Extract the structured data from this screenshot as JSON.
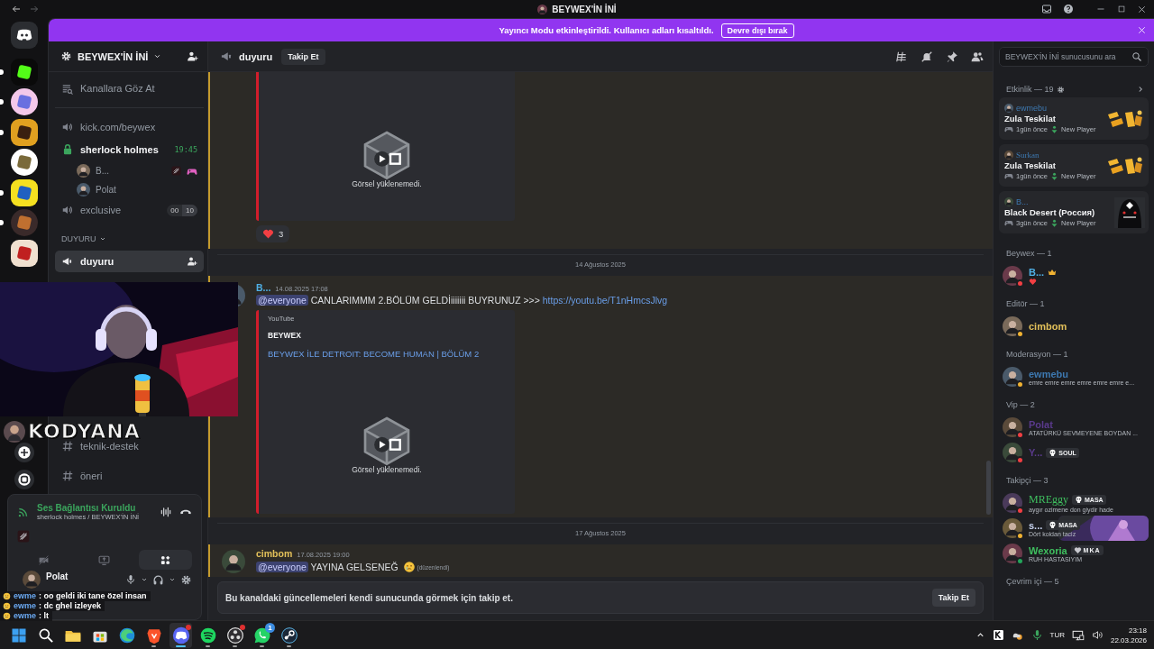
{
  "titlebar": {
    "title": "BEYWEX'İN İNİ"
  },
  "banner": {
    "text": "Yayıncı Modu etkinleştirildi. Kullanıcı adları kısaltıldı.",
    "button": "Devre dışı bırak"
  },
  "servers": [
    {
      "unread": true
    },
    {
      "unread": true
    },
    {
      "unread": true
    },
    {
      "unread": false
    },
    {
      "unread": true
    },
    {
      "unread": true
    },
    {
      "unread": false
    }
  ],
  "server": {
    "name": "BEYWEX'İN İNİ"
  },
  "channel_groups": [
    [
      {
        "kind": "browse",
        "name": "Kanallara Göz At",
        "selected": false,
        "unread": false
      },
      {
        "kind": "voice",
        "name": "kick.com/beywex",
        "selected": false,
        "unread": false
      },
      {
        "kind": "voice-locked",
        "name": "sherlock holmes",
        "timer": "19:45",
        "selected": false,
        "unread": true,
        "members": [
          {
            "name": "B...",
            "deafened": true,
            "activity": true
          },
          {
            "name": "Polat",
            "deafened": false,
            "activity": false
          }
        ]
      },
      {
        "kind": "voice",
        "name": "exclusive",
        "counter": [
          "00",
          "10"
        ],
        "selected": false,
        "unread": false
      },
      {
        "kind": "category",
        "name": "DUYURU"
      },
      {
        "kind": "announcement",
        "name": "duyuru",
        "selected": true,
        "unread": true
      }
    ],
    [
      {
        "kind": "text",
        "name": "teknik-destek",
        "selected": false,
        "unread": false
      },
      {
        "kind": "text",
        "name": "öneri",
        "selected": false,
        "unread": false
      }
    ]
  ],
  "voice_panel": {
    "status": "Ses Bağlantısı Kuruldu",
    "location": "sherlock holmes / BEYWEX'İN İNİ"
  },
  "user_panel": {
    "name": "Polat"
  },
  "chat_header": {
    "channel": "duyuru",
    "follow_button": "Takip Et"
  },
  "messages": [
    {
      "kind": "continuation",
      "mention": true,
      "embed": {
        "image_error": "Görsel yüklenemedi."
      },
      "reactions": [
        {
          "count": "3"
        }
      ]
    },
    {
      "kind": "divider",
      "text": "14 Ağustos 2025"
    },
    {
      "kind": "message",
      "mention": true,
      "author": "B...",
      "color": "#4fb0e6",
      "time": "14.08.2025 17:08",
      "mention_text": "@everyone",
      "text": "CANLARIMMM 2.BÖLÜM GELDİiiiiiii BUYRUNUZ >>>",
      "link": "https://youtu.be/T1nHmcsJlvg",
      "embed": {
        "provider": "YouTube",
        "author": "BEYWEX",
        "title": "BEYWEX İLE DETROIT: BECOME HUMAN | BÖLÜM 2",
        "image_error": "Görsel yüklenemedi."
      }
    },
    {
      "kind": "divider",
      "text": "17 Ağustos 2025"
    },
    {
      "kind": "message",
      "mention": true,
      "author": "cimbom",
      "color": "#e3c15a",
      "time": "17.08.2025 19:00",
      "mention_text": "@everyone",
      "text": "YAYINA GELSENEĞ",
      "emoji": true,
      "edited": "(düzenlendi)"
    }
  ],
  "follow_bar": {
    "text": "Bu kanaldaki güncellemeleri kendi sunucunda görmek için takip et.",
    "button": "Takip Et"
  },
  "search": {
    "placeholder": "BEYWEX'İN İNİ sunucusunu ara"
  },
  "activity": {
    "title": "Etkinlik — 19",
    "cards": [
      {
        "user": "ewmebu",
        "game": "Zula Teskilat",
        "time": "1gün önce",
        "badge": "New Player",
        "kind": "zula"
      },
      {
        "user": "Surkan",
        "game": "Zula Teskilat",
        "time": "1gün önce",
        "badge": "New Player",
        "kind": "zula"
      },
      {
        "user": "B...",
        "game": "Black Desert (Россия)",
        "time": "3gün önce",
        "badge": "New Player",
        "kind": "mask"
      }
    ]
  },
  "member_groups": [
    {
      "title": "Beywex — 1",
      "members": [
        {
          "name": "B...",
          "color": "#4fb0e6",
          "kind": "dnd",
          "crown": true,
          "status_emoji": true
        }
      ]
    },
    {
      "title": "Editör — 1",
      "members": [
        {
          "name": "cimbom",
          "color": "#e3c15a",
          "kind": "idle"
        }
      ]
    },
    {
      "title": "Moderasyon — 1",
      "members": [
        {
          "name": "ewmebu",
          "color": "#3d78b0",
          "kind": "idle",
          "subtext": "emre emre emre emre emre emre e..."
        }
      ]
    },
    {
      "title": "Vip — 2",
      "members": [
        {
          "name": "Polat",
          "color": "#5a3a8c",
          "kind": "dnd",
          "subtext": "ATATÜRKÜ SEVMEYENE BOYDAN ..."
        },
        {
          "name": "Y...",
          "color": "#5a3a8c",
          "kind": "dnd",
          "tag": "SOUL"
        }
      ]
    },
    {
      "title": "Takipçi — 3",
      "members": [
        {
          "name": "MREggy",
          "color": "#3fbf5f",
          "kind": "dnd",
          "tag": "MASA",
          "subtext": "aygır ozimene don giydir hade"
        },
        {
          "name": "s...",
          "color": "#c8d3f0",
          "kind": "idle",
          "tag": "MASA",
          "subtext": "Dört koldan taciz",
          "banner": true
        },
        {
          "name": "Wexoria",
          "color": "#3fbf5f",
          "kind": "online",
          "tag": "MKA",
          "subtext": "RUH HASTASIYIM"
        }
      ]
    },
    {
      "title": "Çevrim içi — 5"
    }
  ],
  "taskbar": {
    "apps": [
      {
        "kind": "start",
        "running": false
      },
      {
        "kind": "search",
        "running": false
      },
      {
        "kind": "folder",
        "running": false
      },
      {
        "kind": "store",
        "running": false
      },
      {
        "kind": "edge",
        "running": false
      },
      {
        "kind": "brave",
        "running": true
      },
      {
        "kind": "discord",
        "running": true,
        "active": true
      },
      {
        "kind": "spotify",
        "running": true
      },
      {
        "kind": "obs",
        "running": true
      },
      {
        "kind": "whatsapp",
        "running": true,
        "badge": "1"
      },
      {
        "kind": "steam",
        "running": true
      }
    ],
    "language": "TUR",
    "time": "23:18",
    "date": "22.03.2026"
  },
  "stream_overlay": {
    "logo": "KODYANA",
    "chat": [
      {
        "user": "ewme",
        "text": ": oo geldi iki tane özel insan"
      },
      {
        "user": "ewme",
        "text": ": dc ghel izleyek"
      },
      {
        "user": "ewme",
        "text": ": lt"
      }
    ]
  }
}
